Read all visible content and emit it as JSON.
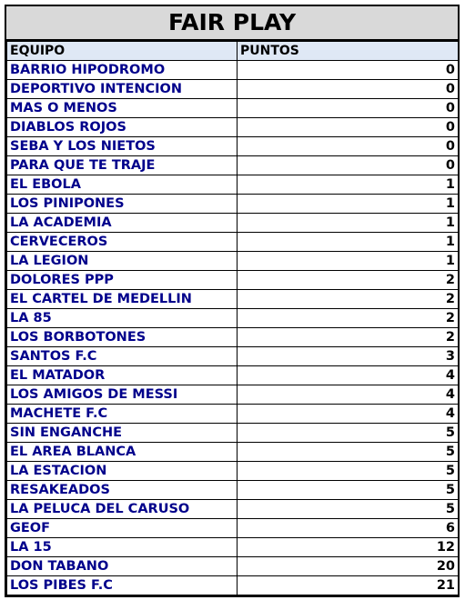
{
  "sheet": {
    "title": "FAIR PLAY",
    "columns": [
      "EQUIPO",
      "PUNTOS"
    ],
    "rows": [
      {
        "team": "BARRIO HIPODROMO",
        "points": "0"
      },
      {
        "team": "DEPORTIVO INTENCION",
        "points": "0"
      },
      {
        "team": "MAS O MENOS",
        "points": "0"
      },
      {
        "team": "DIABLOS ROJOS",
        "points": "0"
      },
      {
        "team": "SEBA Y LOS NIETOS",
        "points": "0"
      },
      {
        "team": "PARA QUE TE TRAJE",
        "points": "0"
      },
      {
        "team": "EL EBOLA",
        "points": "1"
      },
      {
        "team": "LOS PINIPONES",
        "points": "1"
      },
      {
        "team": "LA ACADEMIA",
        "points": "1"
      },
      {
        "team": "CERVECEROS",
        "points": "1"
      },
      {
        "team": "LA LEGION",
        "points": "1"
      },
      {
        "team": "DOLORES PPP",
        "points": "2"
      },
      {
        "team": "EL CARTEL DE MEDELLIN",
        "points": "2"
      },
      {
        "team": "LA 85",
        "points": "2"
      },
      {
        "team": "LOS BORBOTONES",
        "points": "2"
      },
      {
        "team": "SANTOS F.C",
        "points": "3"
      },
      {
        "team": "EL MATADOR",
        "points": "4"
      },
      {
        "team": "LOS AMIGOS DE MESSI",
        "points": "4"
      },
      {
        "team": "MACHETE F.C",
        "points": "4"
      },
      {
        "team": "SIN ENGANCHE",
        "points": "5"
      },
      {
        "team": "EL AREA BLANCA",
        "points": "5"
      },
      {
        "team": "LA ESTACION",
        "points": "5"
      },
      {
        "team": "RESAKEADOS",
        "points": "5"
      },
      {
        "team": "LA PELUCA DEL CARUSO",
        "points": "5"
      },
      {
        "team": "GEOF",
        "points": "6"
      },
      {
        "team": "LA 15",
        "points": "12"
      },
      {
        "team": "DON TABANO",
        "points": "20"
      },
      {
        "team": "LOS PIBES F.C",
        "points": "21"
      }
    ]
  }
}
